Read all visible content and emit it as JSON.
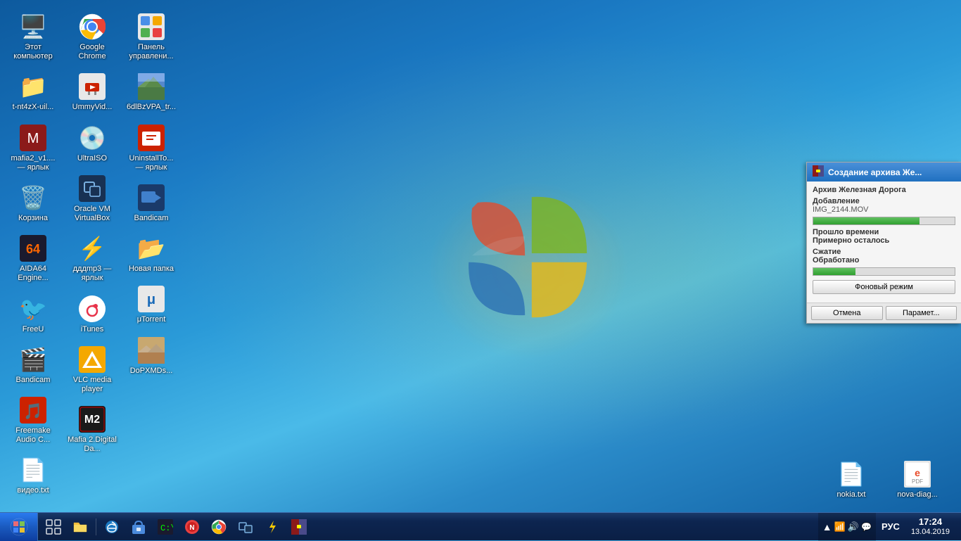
{
  "desktop": {
    "background": "windows7-blue"
  },
  "icons": [
    {
      "id": "this-computer",
      "label": "Этот\nкомпьютер",
      "emoji": "🖥️",
      "col": 0,
      "row": 0
    },
    {
      "id": "t-nt4zx",
      "label": "t-nt4zX-uil...",
      "emoji": "📁",
      "col": 0,
      "row": 1
    },
    {
      "id": "mafia2-shortcut",
      "label": "mafia2_v1....\n— ярлык",
      "emoji": "🎮",
      "col": 0,
      "row": 2
    },
    {
      "id": "recycle-bin",
      "label": "Корзина",
      "emoji": "🗑️",
      "col": 0,
      "row": 3
    },
    {
      "id": "aida64",
      "label": "AIDA64\nEngine...",
      "emoji": "🔢",
      "col": 0,
      "row": 4
    },
    {
      "id": "freeu",
      "label": "FreeU",
      "emoji": "🐦",
      "col": 0,
      "row": 5
    },
    {
      "id": "bandicam2",
      "label": "Bandicam",
      "emoji": "🎬",
      "col": 0,
      "row": 6
    },
    {
      "id": "freemake",
      "label": "Freemake\nAudio C...",
      "emoji": "🎵",
      "col": 1,
      "row": 0
    },
    {
      "id": "video-txt",
      "label": "видео.txt",
      "emoji": "📄",
      "col": 1,
      "row": 1
    },
    {
      "id": "google-chrome",
      "label": "Google\nChrome",
      "emoji": "🌐",
      "col": 1,
      "row": 2
    },
    {
      "id": "ummyvid",
      "label": "UmmyVid...",
      "emoji": "⬇️",
      "col": 1,
      "row": 3
    },
    {
      "id": "ultraiso",
      "label": "UltraISO",
      "emoji": "💿",
      "col": 1,
      "row": 4
    },
    {
      "id": "oracle-vm",
      "label": "Oracle VM\nVirtualBox",
      "emoji": "📦",
      "col": 1,
      "row": 5
    },
    {
      "id": "ddd-mp3",
      "label": "дддmp3\n— ярлык",
      "emoji": "⚡",
      "col": 1,
      "row": 6
    },
    {
      "id": "itunes",
      "label": "iTunes",
      "emoji": "🎵",
      "col": 2,
      "row": 0
    },
    {
      "id": "vlc",
      "label": "VLC media\nplayer",
      "emoji": "🔶",
      "col": 2,
      "row": 1
    },
    {
      "id": "mafia2-digital",
      "label": "Mafia\n2.Digital Da...",
      "emoji": "🕵️",
      "col": 2,
      "row": 2
    },
    {
      "id": "panel",
      "label": "Панель\nуправлени...",
      "emoji": "🖥️",
      "col": 2,
      "row": 3
    },
    {
      "id": "6dlbzvpa",
      "label": "6dlBzVPA_tr...",
      "emoji": "🏔️",
      "col": 2,
      "row": 4
    },
    {
      "id": "uninstalltool",
      "label": "UninstallTo...\n— ярлык",
      "emoji": "📕",
      "col": 2,
      "row": 5
    },
    {
      "id": "bandicam",
      "label": "Bandicam",
      "emoji": "🎥",
      "col": 3,
      "row": 0
    },
    {
      "id": "new-folder",
      "label": "Новая папка",
      "emoji": "📂",
      "col": 3,
      "row": 1
    },
    {
      "id": "utorrent",
      "label": "μTorrent",
      "emoji": "🔵",
      "col": 3,
      "row": 5
    },
    {
      "id": "dopxmds",
      "label": "DoPXMDs...",
      "emoji": "🏜️",
      "col": 3,
      "row": 6
    }
  ],
  "right_icons": [
    {
      "id": "nokia-txt",
      "label": "nokia.txt",
      "emoji": "📄"
    },
    {
      "id": "nova-diag",
      "label": "nova-diag...",
      "emoji": "📋"
    }
  ],
  "winrar": {
    "title": "Создание архива Же...",
    "archive_label": "Архив Железная Дорога",
    "action_label": "Добавление",
    "file": "IMG_2144.MOV",
    "time_passed_label": "Прошло времени",
    "time_passed_value": "",
    "time_remaining_label": "Примерно осталось",
    "time_remaining_value": "",
    "compression_label": "Сжатие",
    "compression_value": "",
    "processed_label": "Обработано",
    "processed_value": "",
    "progress1": 75,
    "progress2": 30,
    "background_btn": "Фоновый режим",
    "cancel_btn": "Отмена",
    "params_btn": "Парамет..."
  },
  "taskbar": {
    "items": [
      {
        "id": "start",
        "emoji": "⊞"
      },
      {
        "id": "task-view",
        "emoji": "🗔"
      },
      {
        "id": "explorer",
        "emoji": "📁"
      },
      {
        "id": "edge",
        "emoji": "🌐"
      },
      {
        "id": "store",
        "emoji": "🏪"
      },
      {
        "id": "cmd",
        "emoji": "⬛"
      },
      {
        "id": "app1",
        "emoji": "🔵"
      },
      {
        "id": "chrome-task",
        "emoji": "🌐"
      },
      {
        "id": "virtualbox-task",
        "emoji": "📦"
      },
      {
        "id": "thunderbolt-task",
        "emoji": "⚡"
      },
      {
        "id": "winrar-task",
        "emoji": "📚"
      }
    ],
    "tray": {
      "icons": [
        "🔺",
        "🔊",
        "📶",
        "🔔",
        "💬"
      ],
      "language": "РУС",
      "time": "17:24",
      "date": "13.04.2019"
    }
  }
}
